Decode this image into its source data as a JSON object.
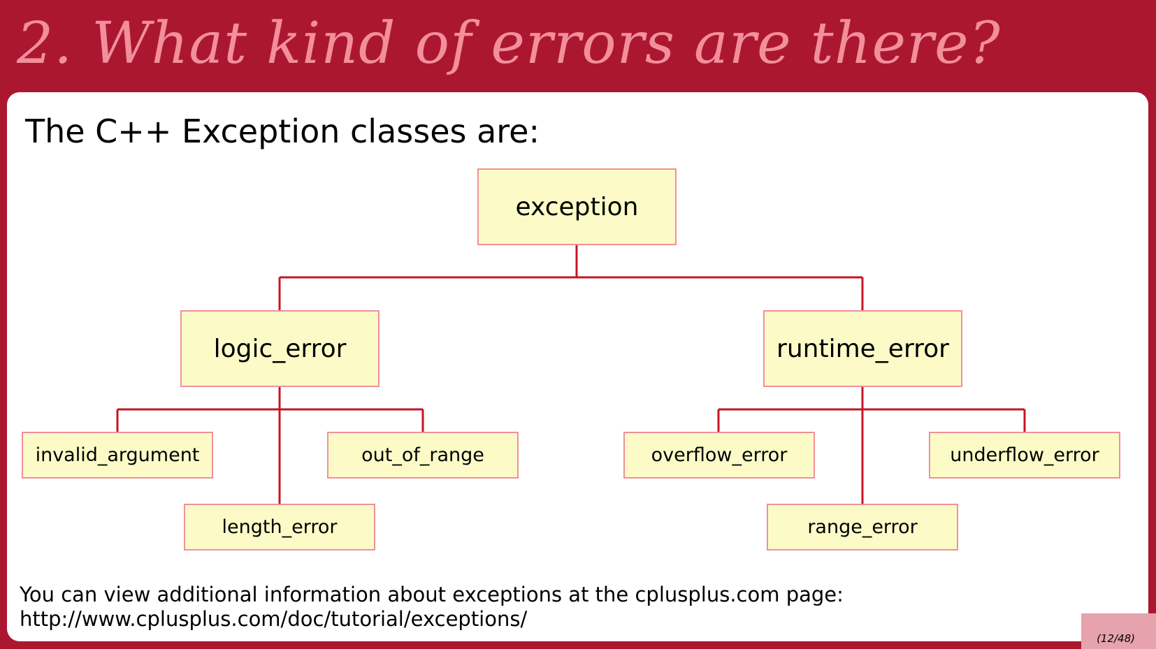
{
  "slide": {
    "title": "2. What kind of errors are there?",
    "heading": "The C++ Exception classes are:",
    "footer_line1": "You can view additional information about exceptions at the cplusplus.com page:",
    "footer_line2": "http://www.cplusplus.com/doc/tutorial/exceptions/",
    "page_number": "(12/48)"
  },
  "colors": {
    "background": "#ac1730",
    "title_text": "#f28f9a",
    "panel": "#ffffff",
    "node_fill": "#fcfbc8",
    "node_border": "#f28f9a",
    "connector": "#c41525"
  },
  "diagram": {
    "root": "exception",
    "children": [
      {
        "label": "logic_error",
        "children": [
          "invalid_argument",
          "length_error",
          "out_of_range"
        ]
      },
      {
        "label": "runtime_error",
        "children": [
          "overflow_error",
          "range_error",
          "underflow_error"
        ]
      }
    ]
  }
}
